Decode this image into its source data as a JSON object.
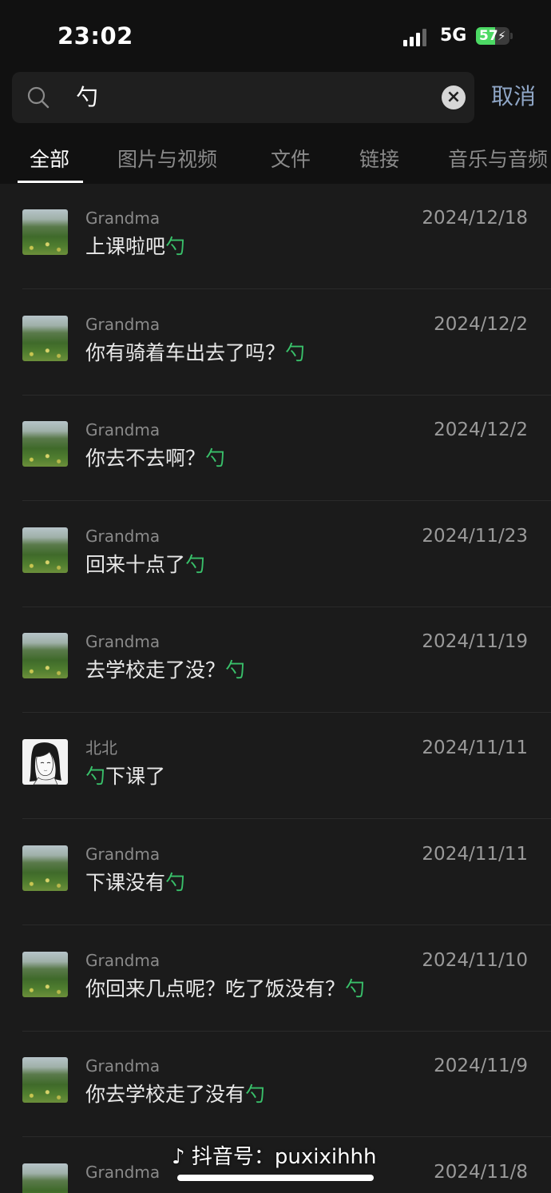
{
  "status_bar": {
    "time": "23:02",
    "network": "5G",
    "battery": "57",
    "battery_level_pct": 57
  },
  "search": {
    "query": "勺",
    "cancel_label": "取消"
  },
  "tabs": [
    {
      "label": "全部",
      "active": true
    },
    {
      "label": "图片与视频",
      "active": false
    },
    {
      "label": "文件",
      "active": false
    },
    {
      "label": "链接",
      "active": false
    },
    {
      "label": "音乐与音频",
      "active": false
    }
  ],
  "results": [
    {
      "sender": "Grandma",
      "date": "2024/12/18",
      "pre": "上课啦吧",
      "match": "勺",
      "post": "",
      "avatar": "landscape"
    },
    {
      "sender": "Grandma",
      "date": "2024/12/2",
      "pre": "你有骑着车出去了吗？",
      "match": "勺",
      "post": "",
      "avatar": "landscape"
    },
    {
      "sender": "Grandma",
      "date": "2024/12/2",
      "pre": "你去不去啊？",
      "match": "勺",
      "post": "",
      "avatar": "landscape"
    },
    {
      "sender": "Grandma",
      "date": "2024/11/23",
      "pre": "回来十点了",
      "match": "勺",
      "post": "",
      "avatar": "landscape"
    },
    {
      "sender": "Grandma",
      "date": "2024/11/19",
      "pre": "去学校走了没？",
      "match": "勺",
      "post": "",
      "avatar": "landscape"
    },
    {
      "sender": "北北",
      "date": "2024/11/11",
      "pre": "",
      "match": "勺",
      "post": "下课了",
      "avatar": "portrait"
    },
    {
      "sender": "Grandma",
      "date": "2024/11/11",
      "pre": "下课没有",
      "match": "勺",
      "post": "",
      "avatar": "landscape"
    },
    {
      "sender": "Grandma",
      "date": "2024/11/10",
      "pre": "你回来几点呢？吃了饭没有？",
      "match": "勺",
      "post": "",
      "avatar": "landscape"
    },
    {
      "sender": "Grandma",
      "date": "2024/11/9",
      "pre": "你去学校走了没有",
      "match": "勺",
      "post": "",
      "avatar": "landscape"
    },
    {
      "sender": "Grandma",
      "date": "2024/11/8",
      "pre": "",
      "match": "",
      "post": "",
      "avatar": "landscape"
    }
  ],
  "watermark": "抖音号：puxixihhh",
  "icons": {
    "search": "search-icon",
    "clear": "clear-icon",
    "tiktok": "tiktok-logo-icon"
  },
  "colors": {
    "highlight": "#39c06a",
    "cancel": "#8fa6c6",
    "battery": "#4cd964"
  }
}
